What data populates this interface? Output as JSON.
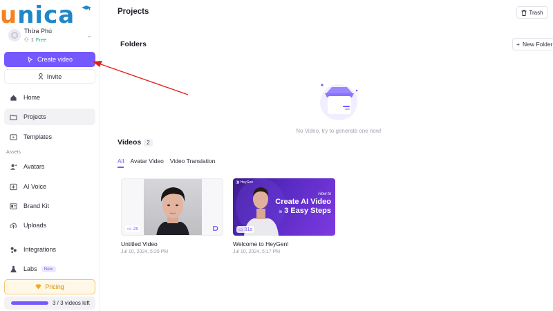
{
  "sidebar": {
    "logo": "unica",
    "account": {
      "name": "Thừa Phú",
      "member_count": "1",
      "plan": "Free"
    },
    "create_label": "Create video",
    "invite_label": "Invite",
    "nav": [
      {
        "label": "Home",
        "icon": "home-icon"
      },
      {
        "label": "Projects",
        "icon": "folder-icon",
        "active": true
      },
      {
        "label": "Templates",
        "icon": "template-icon"
      }
    ],
    "assets_label": "Assets",
    "assets": [
      {
        "label": "Avatars",
        "icon": "avatar-icon"
      },
      {
        "label": "AI Voice",
        "icon": "voice-icon"
      },
      {
        "label": "Brand Kit",
        "icon": "brand-icon"
      },
      {
        "label": "Uploads",
        "icon": "upload-icon"
      }
    ],
    "integrations_label": "Integrations",
    "labs_label": "Labs",
    "labs_badge": "New",
    "pricing_label": "Pricing",
    "usage": {
      "text": "3 / 3 videos left",
      "fraction": 1.0
    }
  },
  "main": {
    "title": "Projects",
    "trash_label": "Trash",
    "folders_title": "Folders",
    "new_folder_label": "New Folder",
    "empty_text": "No Video, try to generate one now!",
    "videos_title": "Videos",
    "videos_count": "2",
    "tabs": [
      {
        "label": "All",
        "active": true
      },
      {
        "label": "Avatar Video"
      },
      {
        "label": "Video Translation"
      }
    ],
    "videos": [
      {
        "title": "Untitled Video",
        "date": "Jul 10, 2024, 5:20 PM",
        "duration": "2s"
      },
      {
        "title": "Welcome to HeyGen!",
        "date": "Jul 10, 2024, 5:17 PM",
        "duration": "31s",
        "promo": {
          "brand": "HeyGen",
          "line1": "How to",
          "line2": "Create AI Video",
          "line3_prefix": "in",
          "line3": "3 Easy Steps"
        }
      }
    ]
  },
  "colors": {
    "accent": "#7559ff",
    "pricing": "#d38b00",
    "annotation_arrow": "#e0201b"
  }
}
